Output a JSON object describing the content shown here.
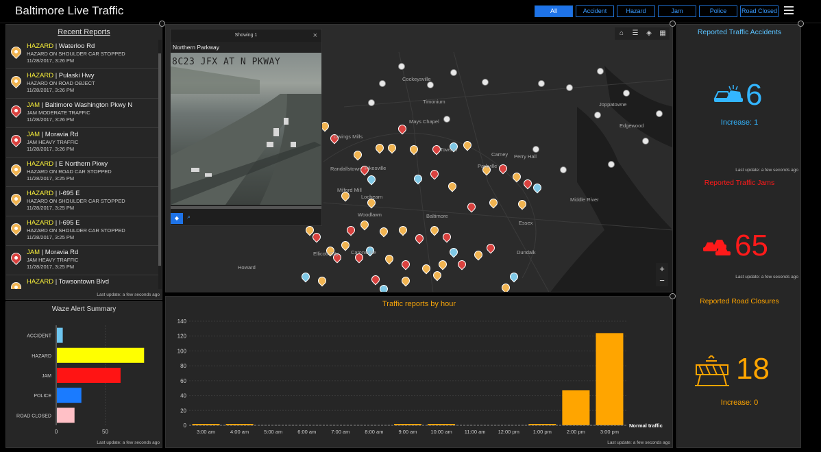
{
  "app": {
    "title": "Baltimore Live Traffic"
  },
  "filters": [
    "All",
    "Accident",
    "Hazard",
    "Jam",
    "Police",
    "Road Closed"
  ],
  "recent": {
    "title": "Recent Reports",
    "updated": "Last update: a few seconds ago",
    "items": [
      {
        "type": "HAZARD",
        "road": " | Waterloo Rd",
        "desc": "HAZARD ON SHOULDER CAR STOPPED",
        "time": "11/28/2017, 3:26 PM",
        "kind": "hz"
      },
      {
        "type": "HAZARD",
        "road": " | Pulaski Hwy",
        "desc": "HAZARD ON ROAD OBJECT",
        "time": "11/28/2017, 3:26 PM",
        "kind": "hz"
      },
      {
        "type": "JAM",
        "road": " | Baltimore Washington Pkwy N",
        "desc": "JAM MODERATE TRAFFIC",
        "time": "11/28/2017, 3:26 PM",
        "kind": "jm"
      },
      {
        "type": "JAM",
        "road": " | Moravia Rd",
        "desc": "JAM HEAVY TRAFFIC",
        "time": "11/28/2017, 3:26 PM",
        "kind": "jm"
      },
      {
        "type": "HAZARD",
        "road": " | E Northern Pkwy",
        "desc": "HAZARD ON ROAD CAR STOPPED",
        "time": "11/28/2017, 3:25 PM",
        "kind": "hz"
      },
      {
        "type": "HAZARD",
        "road": " | I-695 E",
        "desc": "HAZARD ON SHOULDER CAR STOPPED",
        "time": "11/28/2017, 3:25 PM",
        "kind": "hz"
      },
      {
        "type": "HAZARD",
        "road": " | I-695 E",
        "desc": "HAZARD ON SHOULDER CAR STOPPED",
        "time": "11/28/2017, 3:25 PM",
        "kind": "hz"
      },
      {
        "type": "JAM",
        "road": " | Moravia Rd",
        "desc": "JAM HEAVY TRAFFIC",
        "time": "11/28/2017, 3:25 PM",
        "kind": "jm"
      },
      {
        "type": "HAZARD",
        "road": " | Towsontown Blvd",
        "desc": "",
        "time": "",
        "kind": "hz"
      }
    ]
  },
  "waze": {
    "title": "Waze Alert Summary",
    "updated": "Last update: a few seconds ago",
    "chart_data": {
      "type": "bar",
      "orientation": "horizontal",
      "categories": [
        "ACCIDENT",
        "HAZARD",
        "JAM",
        "POLICE",
        "ROAD CLOSED"
      ],
      "values": [
        6,
        89,
        65,
        25,
        18
      ],
      "colors": [
        "#6ec6f0",
        "#ffff00",
        "#ff1414",
        "#1a7bff",
        "#ffc0c6"
      ],
      "xlim": [
        0,
        100
      ],
      "ticks": [
        0,
        50
      ]
    }
  },
  "map": {
    "popup": {
      "header": "Showing 1",
      "title": "Northern Parkway",
      "camera_text": "8C23 JFX AT N PKWAY"
    },
    "places": [
      "Cockeysville",
      "Timonium",
      "Mays Chapel",
      "Towson",
      "Parkville",
      "Perry Hall",
      "Joppatowne",
      "Edgewood",
      "Randallstown",
      "Milford Mill",
      "Pikesville",
      "Lochearn",
      "Woodlawn",
      "Baltimore",
      "Catonsville",
      "Ellicott City",
      "Howard",
      "Essex",
      "Middle River",
      "Dundalk",
      "Owings Mills",
      "Carney"
    ],
    "tools": [
      "home-icon",
      "list-icon",
      "layers-icon",
      "qr-icon"
    ],
    "zoom_in": "+",
    "zoom_out": "−"
  },
  "hourly": {
    "title": "Traffic reports by hour",
    "updated": "Last update: a few seconds ago",
    "chart_data": {
      "type": "bar",
      "categories": [
        "3:00 am",
        "4:00 am",
        "5:00 am",
        "6:00 am",
        "7:00 am",
        "8:00 am",
        "9:00 am",
        "10:00 am",
        "11:00 am",
        "12:00 pm",
        "1:00 pm",
        "2:00 pm",
        "3:00 pm"
      ],
      "values": [
        1,
        1,
        0,
        0,
        0,
        0,
        1,
        1,
        0,
        0,
        1,
        47,
        124
      ],
      "ylim": [
        0,
        140
      ],
      "yticks": [
        0,
        20,
        40,
        60,
        80,
        100,
        120,
        140
      ],
      "guide_label": "Normal traffic",
      "color": "#ffa500"
    }
  },
  "indicators": {
    "accidents": {
      "title": "Reported Traffic Accidents",
      "value": "6",
      "sub": "Increase: 1",
      "updated": "Last update: a few seconds ago",
      "color": "#33b5ff"
    },
    "jams": {
      "title": "Reported Traffic Jams",
      "value": "65",
      "updated": "Last update: a few seconds ago",
      "color": "#ff1a1a"
    },
    "closures": {
      "title": "Reported Road Closures",
      "value": "18",
      "sub": "Increase: 0",
      "color": "#ffa500"
    }
  }
}
